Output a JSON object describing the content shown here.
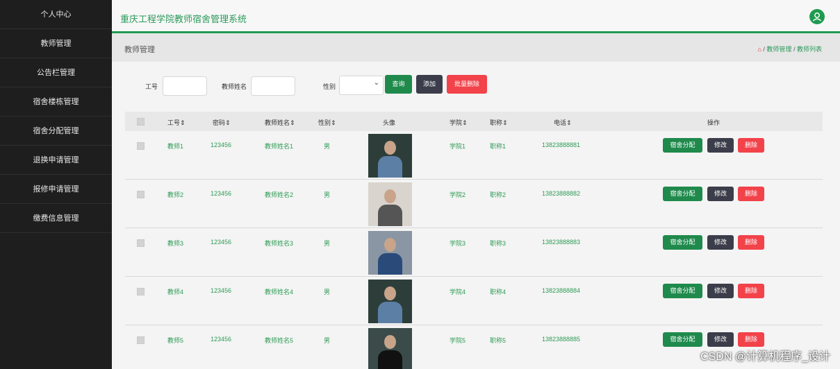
{
  "sidebar": {
    "items": [
      {
        "label": "个人中心"
      },
      {
        "label": "教师管理"
      },
      {
        "label": "公告栏管理"
      },
      {
        "label": "宿舍楼栋管理"
      },
      {
        "label": "宿舍分配管理"
      },
      {
        "label": "退换申请管理"
      },
      {
        "label": "报修申请管理"
      },
      {
        "label": "缴费信息管理"
      }
    ]
  },
  "header": {
    "title": "重庆工程学院教师宿舍管理系统",
    "user_icon": "user-icon"
  },
  "crumbbar": {
    "page_title": "教师管理",
    "home_icon": "⌂",
    "crumb1": "教师管理",
    "crumb2": "教师列表",
    "sep": "/"
  },
  "search": {
    "id_label": "工号",
    "name_label": "教师姓名",
    "gender_label": "性别",
    "query_button": "查询",
    "add_button": "添加",
    "batch_delete_button": "批量删除"
  },
  "table": {
    "headers": [
      "工号",
      "密码",
      "教师姓名",
      "性别",
      "头像",
      "学院",
      "职称",
      "电话",
      "操作"
    ],
    "sort_glyph": "⇕",
    "rows": [
      {
        "id": "教师1",
        "password": "123456",
        "name": "教师姓名1",
        "gender": "男",
        "college": "学院1",
        "title": "职称1",
        "phone": "13823888881"
      },
      {
        "id": "教师2",
        "password": "123456",
        "name": "教师姓名2",
        "gender": "男",
        "college": "学院2",
        "title": "职称2",
        "phone": "13823888882"
      },
      {
        "id": "教师3",
        "password": "123456",
        "name": "教师姓名3",
        "gender": "男",
        "college": "学院3",
        "title": "职称3",
        "phone": "13823888883"
      },
      {
        "id": "教师4",
        "password": "123456",
        "name": "教师姓名4",
        "gender": "男",
        "college": "学院4",
        "title": "职称4",
        "phone": "13823888884"
      },
      {
        "id": "教师5",
        "password": "123456",
        "name": "教师姓名5",
        "gender": "男",
        "college": "学院5",
        "title": "职称5",
        "phone": "13823888885"
      }
    ],
    "actions": {
      "assign": "宿舍分配",
      "edit": "修改",
      "delete": "删除"
    }
  },
  "watermark": "CSDN @计算机程序_设计",
  "colors": {
    "accent": "#1e9b50",
    "danger": "#f2424a",
    "dark": "#3b3e4a",
    "sidebar": "#1e1e1e"
  }
}
